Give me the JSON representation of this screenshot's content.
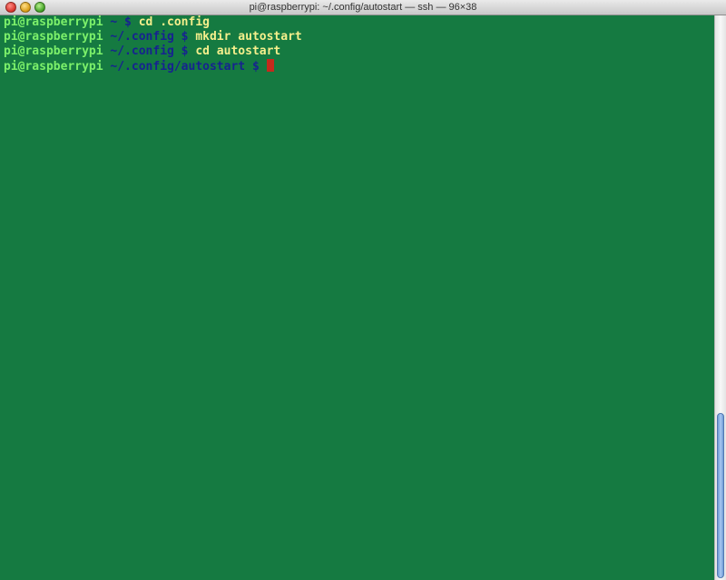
{
  "window": {
    "title": "pi@raspberrypi: ~/.config/autostart — ssh — 96×38"
  },
  "terminal": {
    "lines": [
      {
        "user": "pi@raspberrypi",
        "path": " ~ $ ",
        "command": "cd .config"
      },
      {
        "user": "pi@raspberrypi",
        "path": " ~/.config $ ",
        "command": "mkdir autostart"
      },
      {
        "user": "pi@raspberrypi",
        "path": " ~/.config $ ",
        "command": "cd autostart"
      },
      {
        "user": "pi@raspberrypi",
        "path": " ~/.config/autostart $ ",
        "command": ""
      }
    ]
  },
  "colors": {
    "background": "#157a41",
    "user": "#7cf06a",
    "path": "#16238f",
    "command": "#f5ef8c",
    "cursor": "#c42a1c"
  },
  "icons": {
    "close": "close-button-icon",
    "minimize": "minimize-button-icon",
    "zoom": "zoom-button-icon"
  }
}
